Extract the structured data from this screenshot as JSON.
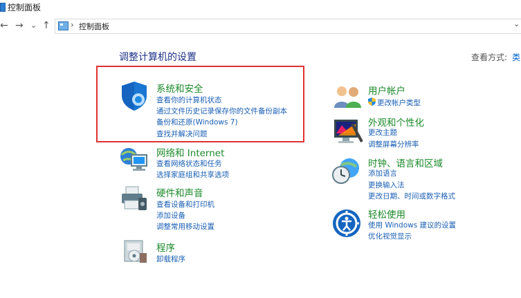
{
  "window": {
    "title": "控制面板"
  },
  "nav": {
    "back": "←",
    "forward": "→",
    "recent": "⌄",
    "up": "↑",
    "separator": "›",
    "address": "控制面板",
    "dropdown": "⌄"
  },
  "heading": "调整计算机的设置",
  "view_by": {
    "label": "查看方式:",
    "value": "类"
  },
  "categories": [
    {
      "title": "系统和安全",
      "links": [
        "查看你的计算机状态",
        "通过文件历史记录保存你的文件备份副本",
        "备份和还原(Windows 7)",
        "查找并解决问题"
      ]
    },
    {
      "title": "网络和 Internet",
      "links": [
        "查看网络状态和任务",
        "选择家庭组和共享选项"
      ]
    },
    {
      "title": "硬件和声音",
      "links": [
        "查看设备和打印机",
        "添加设备",
        "调整常用移动设置"
      ]
    },
    {
      "title": "程序",
      "links": [
        "卸载程序"
      ]
    },
    {
      "title": "用户帐户",
      "links": [
        "更改帐户类型"
      ]
    },
    {
      "title": "外观和个性化",
      "links": [
        "更改主题",
        "调整屏幕分辨率"
      ]
    },
    {
      "title": "时钟、语言和区域",
      "links": [
        "添加语言",
        "更换输入法",
        "更改日期、时间或数字格式"
      ]
    },
    {
      "title": "轻松使用",
      "links": [
        "使用 Windows 建议的设置",
        "优化视觉显示"
      ]
    }
  ],
  "colors": {
    "category_title": "#1b8a2a",
    "link": "#1a5fb4",
    "heading": "#1e3287",
    "highlight": "#e0312f"
  }
}
